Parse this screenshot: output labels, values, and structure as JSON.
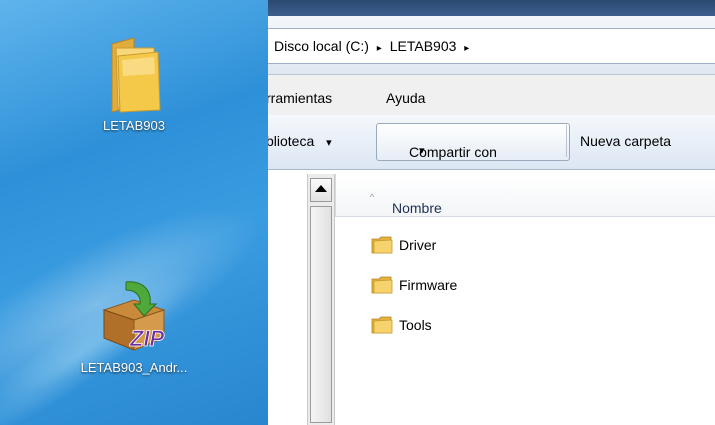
{
  "desktop": {
    "icons": [
      {
        "label": "LETAB903",
        "icon": "folder-icon"
      },
      {
        "label": "LETAB903_Andr...",
        "icon": "zip-archive-icon"
      }
    ]
  },
  "explorer": {
    "address": {
      "root": "Disco local (C:)",
      "folder": "LETAB903",
      "separator": "▸",
      "dropdown": "▾"
    },
    "menu": {
      "items": [
        "rramientas",
        "Ayuda"
      ]
    },
    "toolbar": {
      "library": "blioteca",
      "share": "Compartir con",
      "new_folder": "Nueva carpeta",
      "dropdown": "▾"
    },
    "list": {
      "column_header": "Nombre",
      "sort_indicator": "^",
      "items": [
        {
          "name": "Driver",
          "icon": "folder-icon"
        },
        {
          "name": "Firmware",
          "icon": "folder-icon"
        },
        {
          "name": "Tools",
          "icon": "folder-icon"
        }
      ]
    }
  },
  "colors": {
    "desktop_bg": "#2e90d8",
    "folder_yellow": "#f4c94a",
    "titlebar": "#2a4a72"
  }
}
